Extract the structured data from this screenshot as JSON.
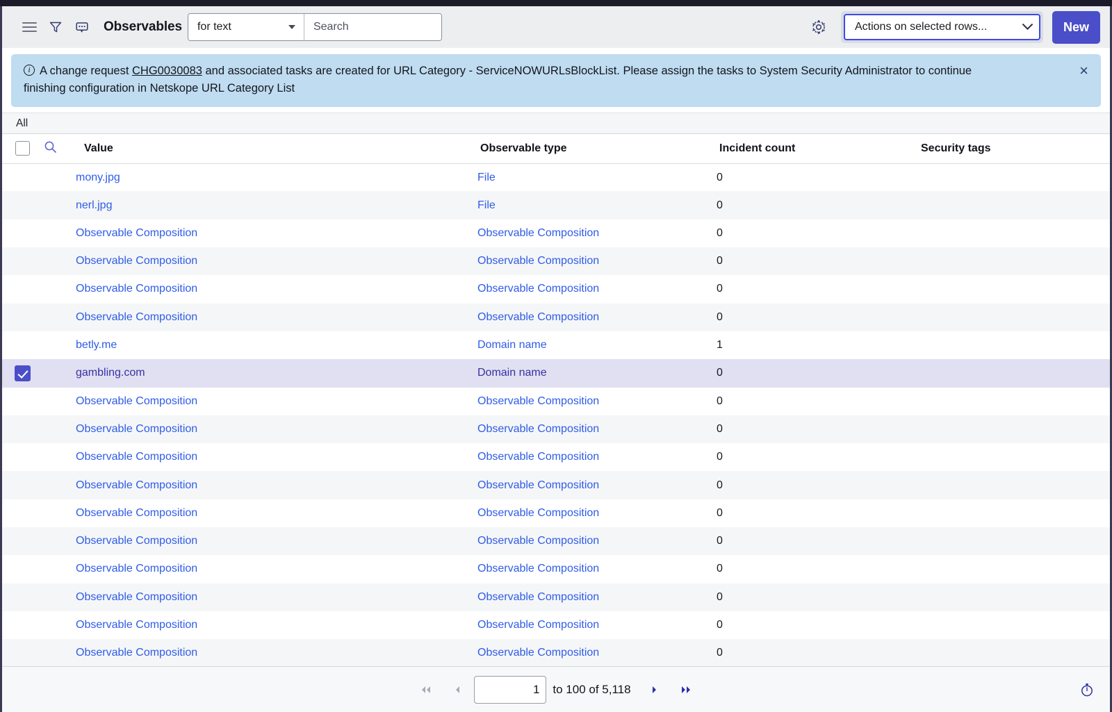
{
  "toolbar": {
    "menu_icon": "hamburger-menu-icon",
    "filter_icon": "filter-funnel-icon",
    "comment_icon": "comment-bubble-icon",
    "title": "Observables",
    "search_scope": "for text",
    "search_placeholder": "Search",
    "search_value": "",
    "gear_icon": "gear-icon",
    "actions_selected": "Actions on selected rows...",
    "new_label": "New",
    "accent_color": "#4a4ec8",
    "focus_ring_color": "#3d4be0"
  },
  "banner": {
    "info_icon": "info-circle-icon",
    "text_before": "A change request ",
    "link": "CHG0030083",
    "text_after": " and associated tasks are created for URL Category - ServiceNOWURLsBlockList. Please assign the tasks to System Security Administrator to continue finishing configuration in Netskope URL Category List",
    "close_label": "×",
    "background_color": "#bfdcf1"
  },
  "tabs": {
    "all_label": "All"
  },
  "table": {
    "headers": {
      "checkbox": "",
      "search": "",
      "value": "Value",
      "observable_type": "Observable type",
      "incident_count": "Incident count",
      "security_tags": "Security tags"
    },
    "rows": [
      {
        "value": "mony.jpg",
        "type": "File",
        "count": "0",
        "tags": "",
        "selected": false
      },
      {
        "value": "nerl.jpg",
        "type": "File",
        "count": "0",
        "tags": "",
        "selected": false
      },
      {
        "value": "Observable Composition",
        "type": "Observable Composition",
        "count": "0",
        "tags": "",
        "selected": false
      },
      {
        "value": "Observable Composition",
        "type": "Observable Composition",
        "count": "0",
        "tags": "",
        "selected": false
      },
      {
        "value": "Observable Composition",
        "type": "Observable Composition",
        "count": "0",
        "tags": "",
        "selected": false
      },
      {
        "value": "Observable Composition",
        "type": "Observable Composition",
        "count": "0",
        "tags": "",
        "selected": false
      },
      {
        "value": "betly.me",
        "type": "Domain name",
        "count": "1",
        "tags": "",
        "selected": false
      },
      {
        "value": "gambling.com",
        "type": "Domain name",
        "count": "0",
        "tags": "",
        "selected": true
      },
      {
        "value": "Observable Composition",
        "type": "Observable Composition",
        "count": "0",
        "tags": "",
        "selected": false
      },
      {
        "value": "Observable Composition",
        "type": "Observable Composition",
        "count": "0",
        "tags": "",
        "selected": false
      },
      {
        "value": "Observable Composition",
        "type": "Observable Composition",
        "count": "0",
        "tags": "",
        "selected": false
      },
      {
        "value": "Observable Composition",
        "type": "Observable Composition",
        "count": "0",
        "tags": "",
        "selected": false
      },
      {
        "value": "Observable Composition",
        "type": "Observable Composition",
        "count": "0",
        "tags": "",
        "selected": false
      },
      {
        "value": "Observable Composition",
        "type": "Observable Composition",
        "count": "0",
        "tags": "",
        "selected": false
      },
      {
        "value": "Observable Composition",
        "type": "Observable Composition",
        "count": "0",
        "tags": "",
        "selected": false
      },
      {
        "value": "Observable Composition",
        "type": "Observable Composition",
        "count": "0",
        "tags": "",
        "selected": false
      },
      {
        "value": "Observable Composition",
        "type": "Observable Composition",
        "count": "0",
        "tags": "",
        "selected": false
      },
      {
        "value": "Observable Composition",
        "type": "Observable Composition",
        "count": "0",
        "tags": "",
        "selected": false
      }
    ],
    "link_color": "#2f5ce8",
    "selected_row_color": "#e0e0f2"
  },
  "footer": {
    "first_icon": "first-page-icon",
    "prev_icon": "previous-page-icon",
    "page_value": "1",
    "range_label": "to 100 of 5,118",
    "next_icon": "next-page-icon",
    "last_icon": "last-page-icon",
    "clock_icon": "stopwatch-icon"
  }
}
